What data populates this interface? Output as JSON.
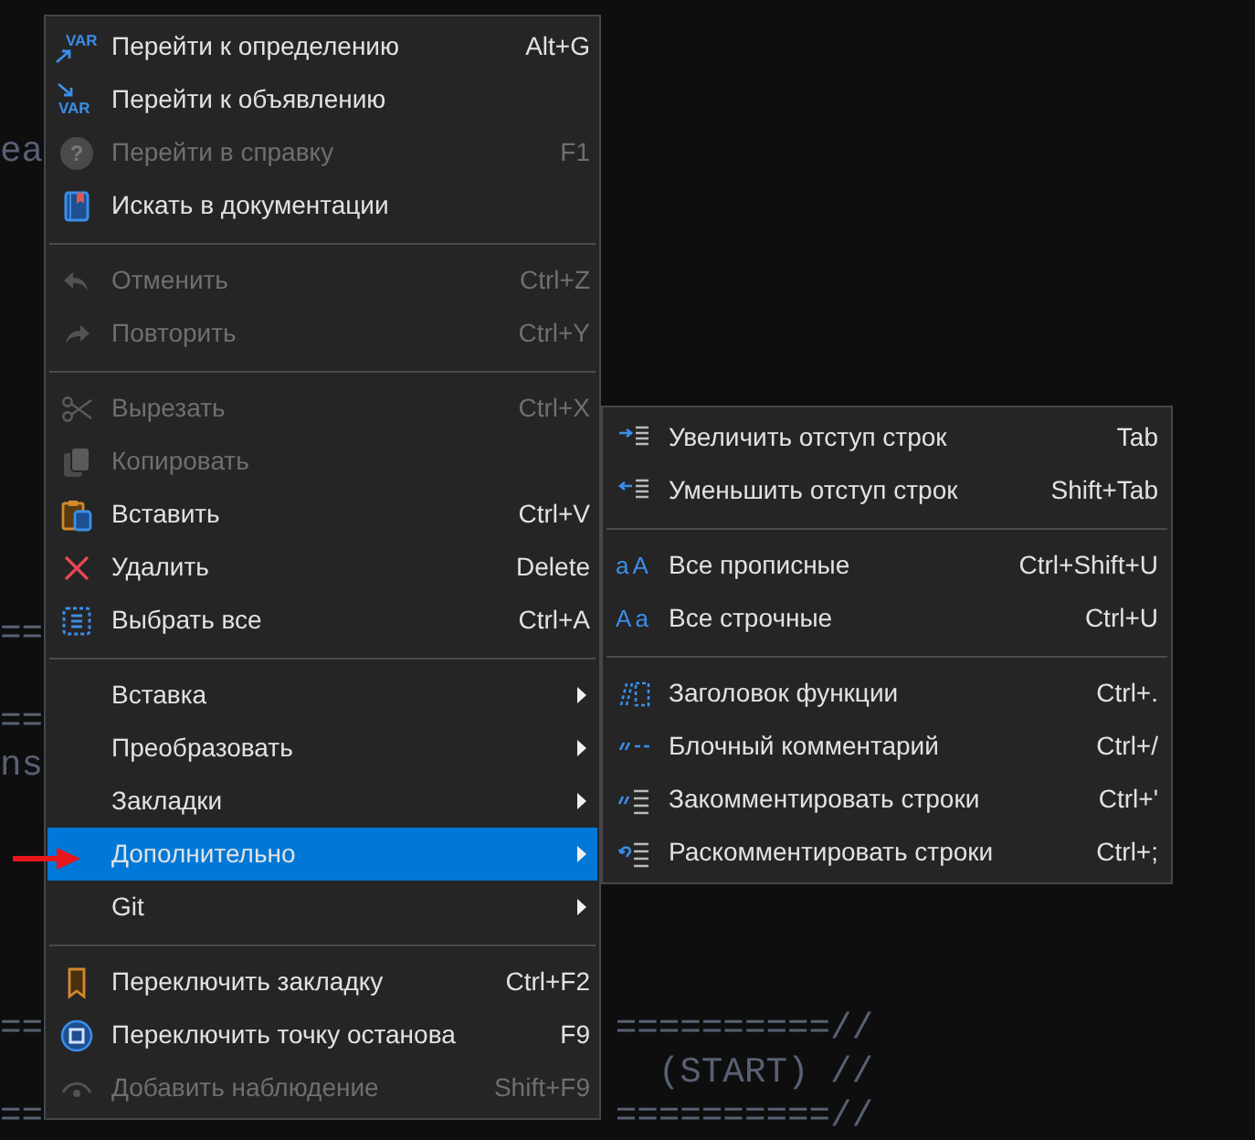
{
  "code_lines": [
    {
      "left": "ea"
    },
    {
      "left": "=="
    },
    {
      "left": "=="
    },
    {
      "left": "ns"
    },
    {
      "left": "==",
      "right": "==========//"
    },
    {
      "right": "(START) //"
    },
    {
      "left": "==",
      "right": "==========//"
    }
  ],
  "context_menu": {
    "items": [
      {
        "kind": "item",
        "label": "Перейти к определению",
        "shortcut": "Alt+G",
        "icon_text": "VAR",
        "disabled": false
      },
      {
        "kind": "item",
        "label": "Перейти к объявлению",
        "icon_text": "VAR",
        "disabled": false
      },
      {
        "kind": "item",
        "label": "Перейти в справку",
        "shortcut": "F1",
        "icon_text": "?",
        "disabled": true
      },
      {
        "kind": "item",
        "label": "Искать в документации",
        "disabled": false
      },
      {
        "kind": "separator"
      },
      {
        "kind": "item",
        "label": "Отменить",
        "shortcut": "Ctrl+Z",
        "disabled": true
      },
      {
        "kind": "item",
        "label": "Повторить",
        "shortcut": "Ctrl+Y",
        "disabled": true
      },
      {
        "kind": "separator"
      },
      {
        "kind": "item",
        "label": "Вырезать",
        "shortcut": "Ctrl+X",
        "disabled": true
      },
      {
        "kind": "item",
        "label": "Копировать",
        "disabled": true
      },
      {
        "kind": "item",
        "label": "Вставить",
        "shortcut": "Ctrl+V",
        "disabled": false
      },
      {
        "kind": "item",
        "label": "Удалить",
        "shortcut": "Delete",
        "disabled": false
      },
      {
        "kind": "item",
        "label": "Выбрать все",
        "shortcut": "Ctrl+A",
        "disabled": false
      },
      {
        "kind": "separator"
      },
      {
        "kind": "submenu",
        "label": "Вставка",
        "selected": false
      },
      {
        "kind": "submenu",
        "label": "Преобразовать",
        "selected": false
      },
      {
        "kind": "submenu",
        "label": "Закладки",
        "selected": false
      },
      {
        "kind": "submenu",
        "label": "Дополнительно",
        "selected": true
      },
      {
        "kind": "submenu",
        "label": "Git",
        "selected": false
      },
      {
        "kind": "separator"
      },
      {
        "kind": "item",
        "label": "Переключить закладку",
        "shortcut": "Ctrl+F2",
        "disabled": false
      },
      {
        "kind": "item",
        "label": "Переключить точку останова",
        "shortcut": "F9",
        "disabled": false
      },
      {
        "kind": "item",
        "label": "Добавить наблюдение",
        "shortcut": "Shift+F9",
        "disabled": true
      }
    ]
  },
  "submenu": {
    "items": [
      {
        "kind": "item",
        "label": "Увеличить отступ строк",
        "shortcut": "Tab"
      },
      {
        "kind": "item",
        "label": "Уменьшить отступ строк",
        "shortcut": "Shift+Tab"
      },
      {
        "kind": "separator"
      },
      {
        "kind": "item",
        "label": "Все прописные",
        "shortcut": "Ctrl+Shift+U",
        "icon_text": "aA"
      },
      {
        "kind": "item",
        "label": "Все строчные",
        "shortcut": "Ctrl+U",
        "icon_text": "Aa"
      },
      {
        "kind": "separator"
      },
      {
        "kind": "item",
        "label": "Заголовок функции",
        "shortcut": "Ctrl+."
      },
      {
        "kind": "item",
        "label": "Блочный комментарий",
        "shortcut": "Ctrl+/"
      },
      {
        "kind": "item",
        "label": "Закомментировать строки",
        "shortcut": "Ctrl+'"
      },
      {
        "kind": "item",
        "label": "Раскомментировать строки",
        "shortcut": "Ctrl+;"
      }
    ]
  }
}
